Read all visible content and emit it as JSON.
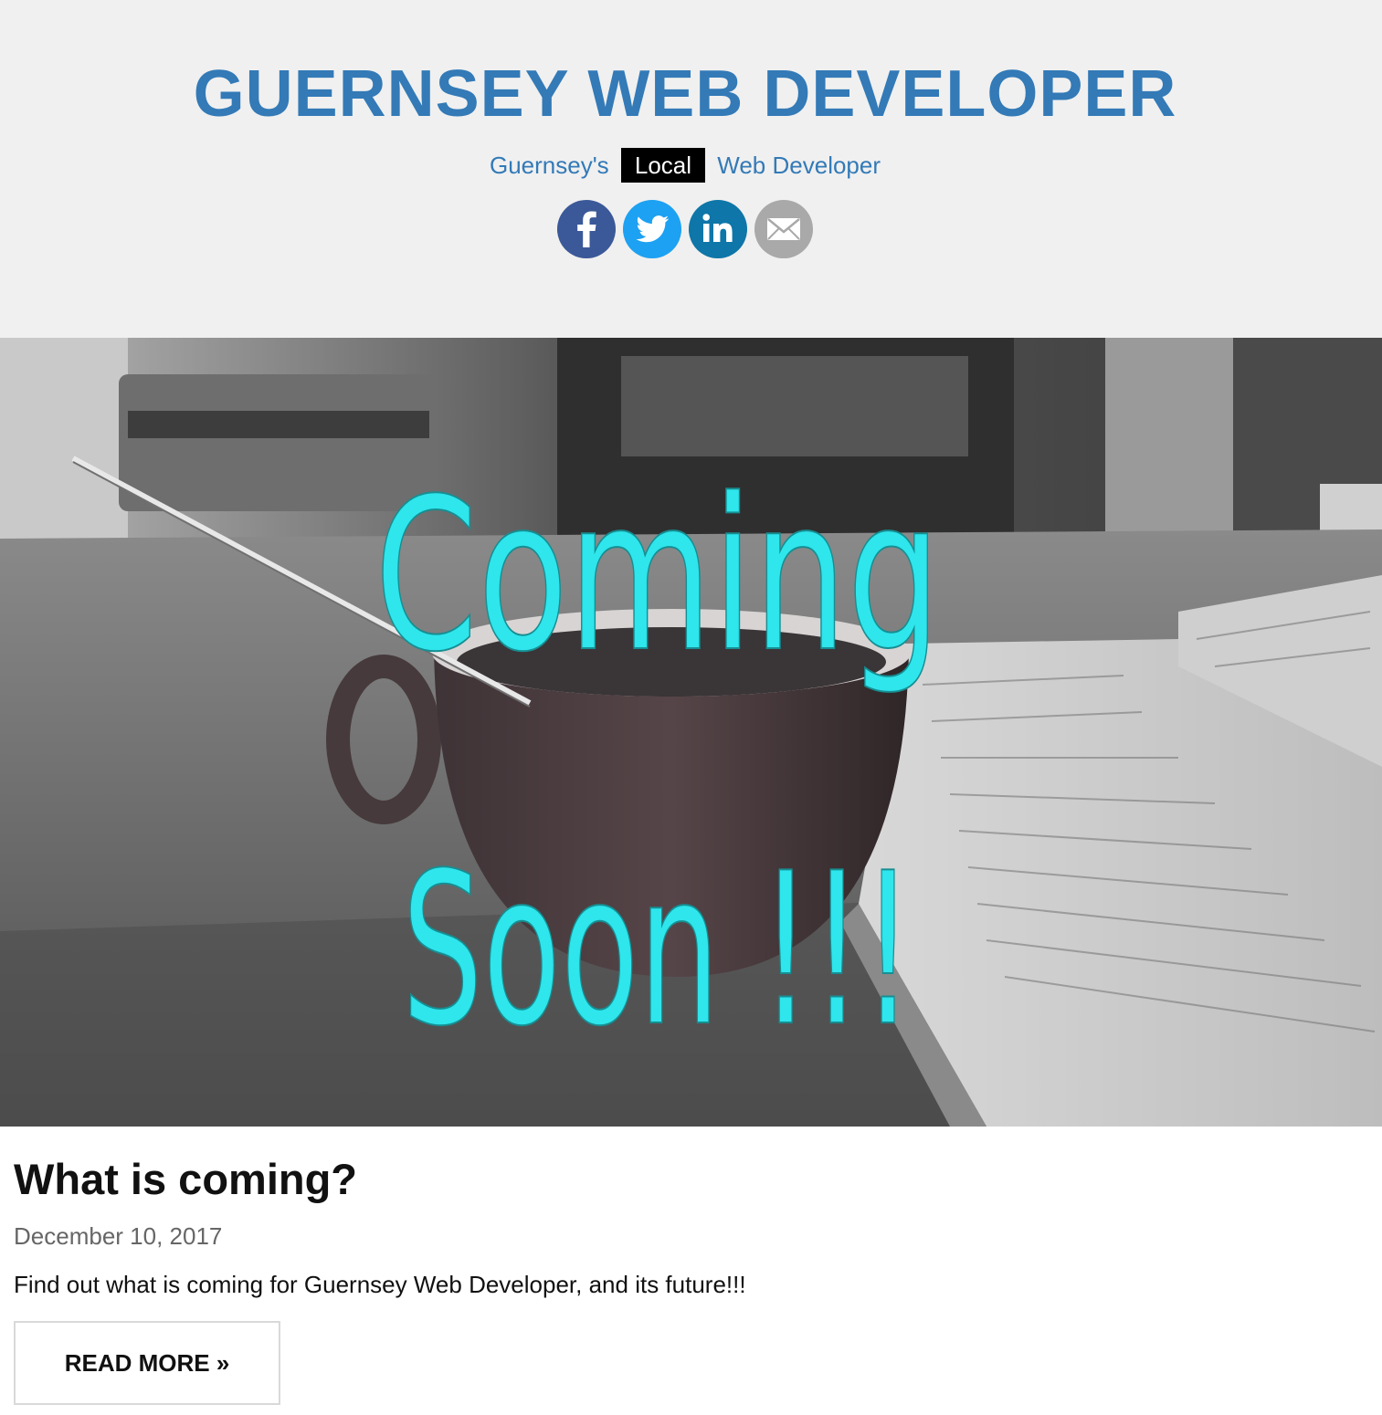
{
  "header": {
    "site_title": "GUERNSEY WEB DEVELOPER",
    "tagline": {
      "before": "Guernsey's",
      "highlight": "Local",
      "after": "Web Developer"
    },
    "social": [
      {
        "name": "facebook",
        "icon": "facebook-icon",
        "color": "#3b5998"
      },
      {
        "name": "twitter",
        "icon": "twitter-icon",
        "color": "#1da1f2"
      },
      {
        "name": "linkedin",
        "icon": "linkedin-icon",
        "color": "#0e76a8"
      },
      {
        "name": "email",
        "icon": "email-icon",
        "color": "#a9a9a9"
      }
    ]
  },
  "hero": {
    "overlay_line_1": "Coming",
    "overlay_line_2": "Soon !!!",
    "overlay_color": "#2ee6ec"
  },
  "post": {
    "title": "What is coming?",
    "date": "December 10, 2017",
    "excerpt": "Find out what is coming for Guernsey Web Developer, and its future!!!",
    "read_more_label": "READ MORE »"
  },
  "colors": {
    "brand": "#337ab7",
    "header_bg": "#f0f0f0"
  }
}
